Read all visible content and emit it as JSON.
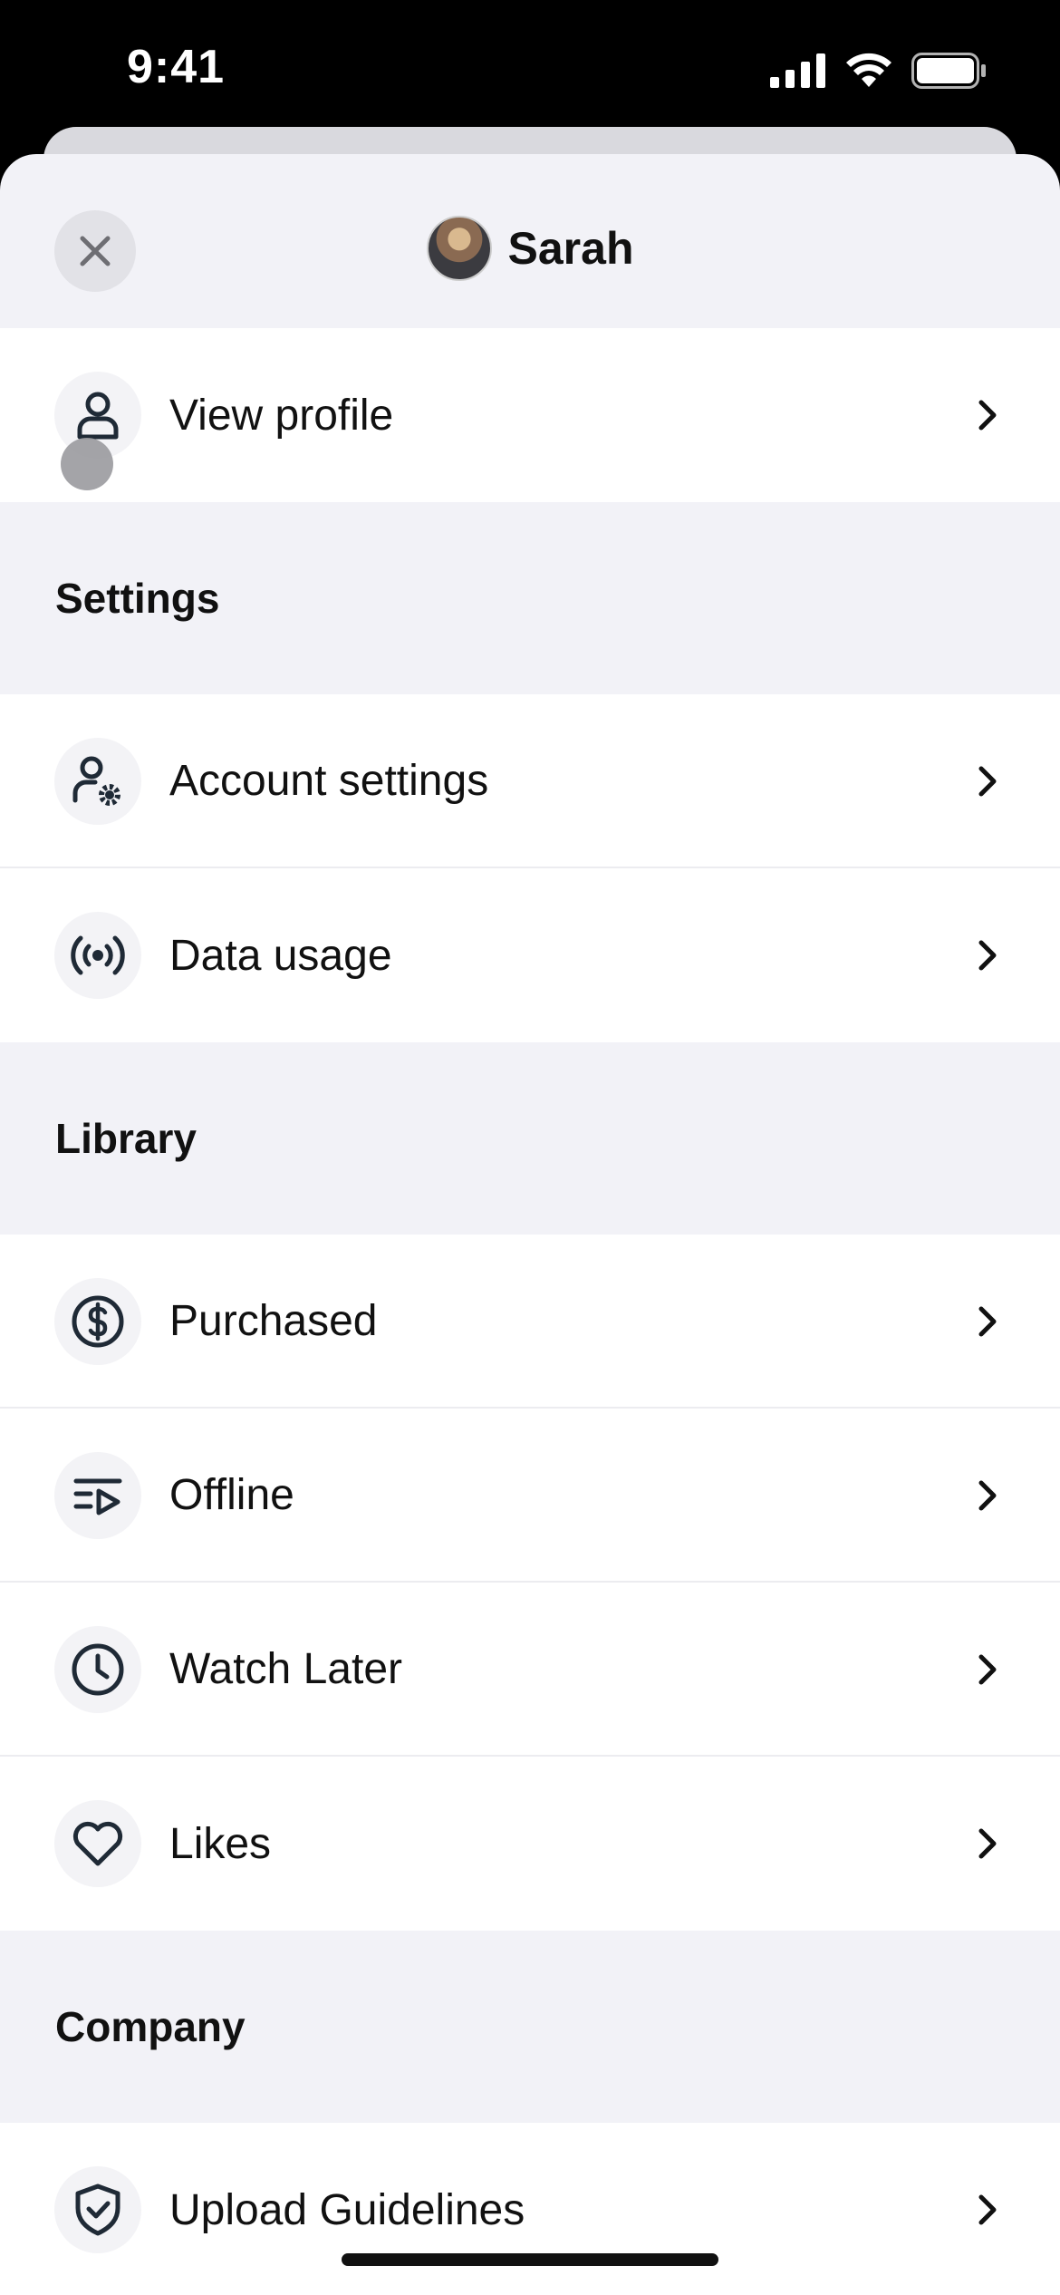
{
  "status_bar": {
    "time": "9:41"
  },
  "header": {
    "user_name": "Sarah"
  },
  "profile": {
    "view_profile_label": "View profile"
  },
  "sections": {
    "settings": {
      "title": "Settings",
      "items": [
        {
          "label": "Account settings",
          "icon": "account-settings-icon"
        },
        {
          "label": "Data usage",
          "icon": "broadcast-icon"
        }
      ]
    },
    "library": {
      "title": "Library",
      "items": [
        {
          "label": "Purchased",
          "icon": "dollar-circle-icon"
        },
        {
          "label": "Offline",
          "icon": "playlist-play-icon"
        },
        {
          "label": "Watch Later",
          "icon": "clock-icon"
        },
        {
          "label": "Likes",
          "icon": "heart-icon"
        }
      ]
    },
    "company": {
      "title": "Company",
      "items": [
        {
          "label": "Upload Guidelines",
          "icon": "shield-check-icon"
        }
      ]
    }
  },
  "colors": {
    "sheet_bg": "#f2f2f7",
    "row_bg": "#ffffff",
    "icon_stroke": "#1f2a36"
  }
}
